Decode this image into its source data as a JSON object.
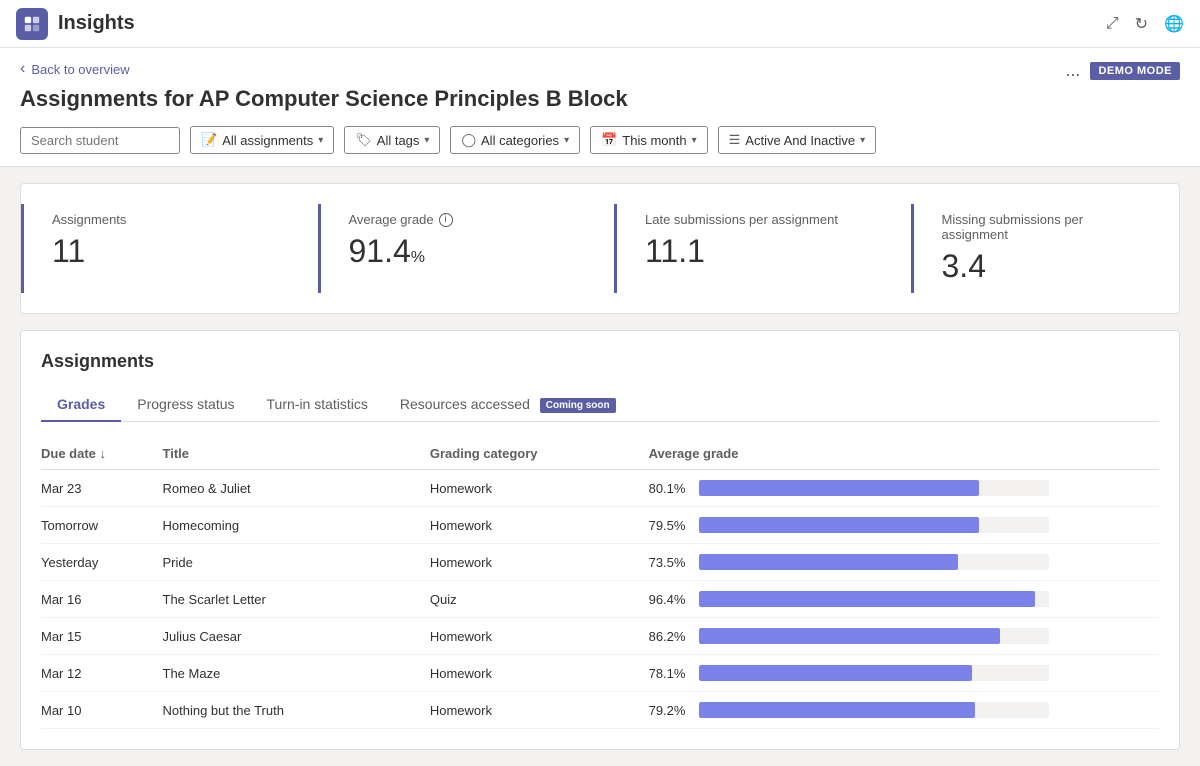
{
  "app": {
    "title": "Insights"
  },
  "header": {
    "back_label": "Back to overview",
    "page_title": "Assignments for AP Computer Science Principles B Block",
    "more_label": "...",
    "demo_mode_label": "DEMO MODE"
  },
  "filters": {
    "search_placeholder": "Search student",
    "assignments_label": "All assignments",
    "tags_label": "All tags",
    "categories_label": "All categories",
    "month_label": "This month",
    "status_label": "Active And Inactive"
  },
  "stats": [
    {
      "label": "Assignments",
      "value": "11",
      "unit": "",
      "has_info": false
    },
    {
      "label": "Average grade",
      "value": "91.4",
      "unit": "%",
      "has_info": true
    },
    {
      "label": "Late submissions per assignment",
      "value": "11.1",
      "unit": "",
      "has_info": false
    },
    {
      "label": "Missing submissions per assignment",
      "value": "3.4",
      "unit": "",
      "has_info": false
    }
  ],
  "assignments_section": {
    "title": "Assignments",
    "tabs": [
      {
        "label": "Grades",
        "active": true,
        "badge": null
      },
      {
        "label": "Progress status",
        "active": false,
        "badge": null
      },
      {
        "label": "Turn-in statistics",
        "active": false,
        "badge": null
      },
      {
        "label": "Resources accessed",
        "active": false,
        "badge": "Coming soon"
      }
    ],
    "table": {
      "headers": [
        {
          "label": "Due date",
          "sortable": true
        },
        {
          "label": "Title",
          "sortable": false
        },
        {
          "label": "Grading category",
          "sortable": false
        },
        {
          "label": "Average grade",
          "sortable": false
        }
      ],
      "rows": [
        {
          "due": "Mar 23",
          "title": "Romeo & Juliet",
          "category": "Homework",
          "grade": 80.1
        },
        {
          "due": "Tomorrow",
          "title": "Homecoming",
          "category": "Homework",
          "grade": 79.5
        },
        {
          "due": "Yesterday",
          "title": "Pride",
          "category": "Homework",
          "grade": 73.5
        },
        {
          "due": "Mar 16",
          "title": "The Scarlet Letter",
          "category": "Quiz",
          "grade": 96.4
        },
        {
          "due": "Mar 15",
          "title": "Julius Caesar",
          "category": "Homework",
          "grade": 86.2
        },
        {
          "due": "Mar 12",
          "title": "The Maze",
          "category": "Homework",
          "grade": 78.1
        },
        {
          "due": "Mar 10",
          "title": "Nothing but the Truth",
          "category": "Homework",
          "grade": 79.2
        }
      ]
    }
  },
  "icons": {
    "back_chevron": "‹",
    "chevron_down": "⌄",
    "sort_down": "↓",
    "info": "i"
  }
}
